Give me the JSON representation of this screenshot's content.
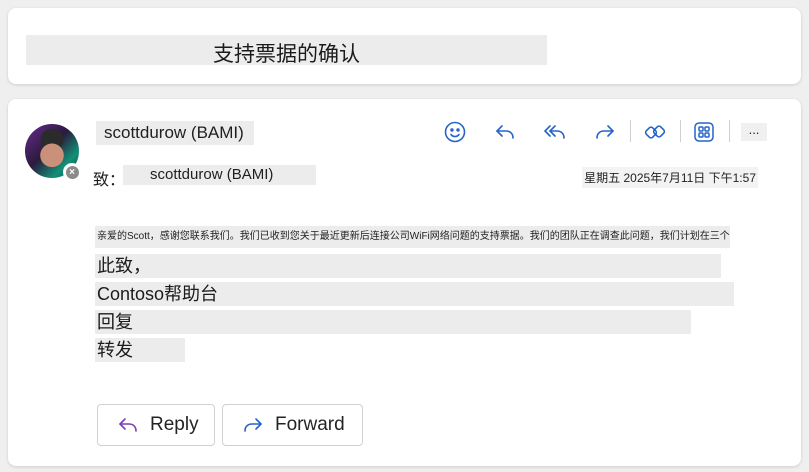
{
  "subject": "支持票据的确认",
  "sender": {
    "name": "scottdurow (BAMI)"
  },
  "recipient": {
    "label": "致：",
    "name": "scottdurow (BAMI)"
  },
  "timestamp": "星期五 2025年7月11日 下午1:57",
  "toolbar": {
    "icons": [
      "emoji-icon",
      "reply-icon",
      "reply-all-icon",
      "forward-icon",
      "loop-icon",
      "apps-icon"
    ],
    "more_label": "...",
    "accent_color": "#2563c9"
  },
  "body": {
    "text": "亲爱的Scott，感谢您联系我们。我们已收到您关于最近更新后连接公司WiFi网络问题的支持票据。我们的团队正在调查此问题，我们计划在三个工作日内回复您。",
    "signature": [
      "此致，",
      "Contoso帮助台",
      "回复",
      "转发"
    ]
  },
  "actions": {
    "reply_label": "Reply",
    "forward_label": "Forward"
  }
}
